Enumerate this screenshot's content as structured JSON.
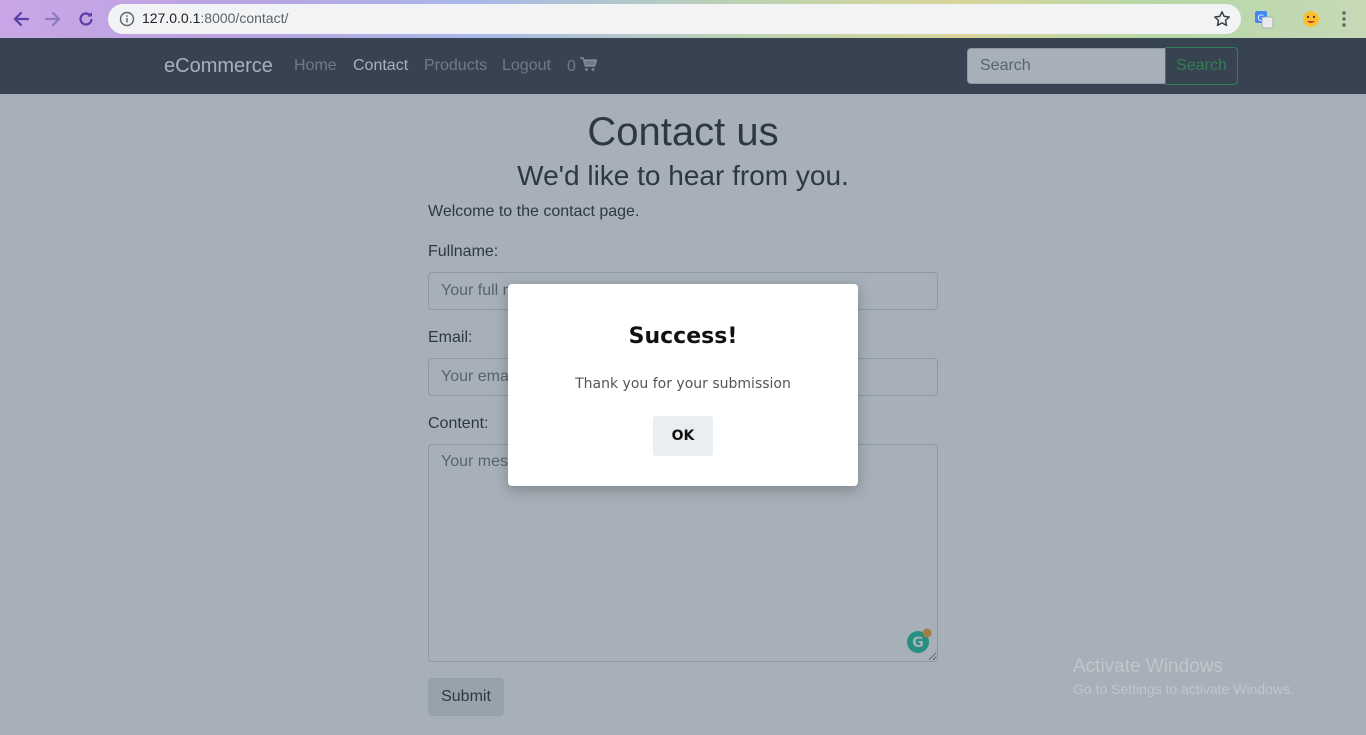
{
  "browser": {
    "url_host": "127.0.0.1",
    "url_rest": ":8000/contact/"
  },
  "navbar": {
    "brand": "eCommerce",
    "links": [
      "Home",
      "Contact",
      "Products",
      "Logout"
    ],
    "cart_count": "0",
    "search_placeholder": "Search",
    "search_button": "Search"
  },
  "page": {
    "title": "Contact us",
    "subtitle": "We'd like to hear from you.",
    "intro": "Welcome to the contact page.",
    "fullname_label": "Fullname:",
    "fullname_placeholder": "Your full name",
    "email_label": "Email:",
    "email_placeholder": "Your email",
    "content_label": "Content:",
    "content_placeholder": "Your message",
    "submit": "Submit"
  },
  "modal": {
    "title": "Success!",
    "text": "Thank you for your submission",
    "ok": "OK"
  },
  "watermark": {
    "title": "Activate Windows",
    "subtitle": "Go to Settings to activate Windows."
  },
  "colors": {
    "navbar": "#343a40",
    "search_outline": "#28a745",
    "grammarly": "#15c39a"
  }
}
